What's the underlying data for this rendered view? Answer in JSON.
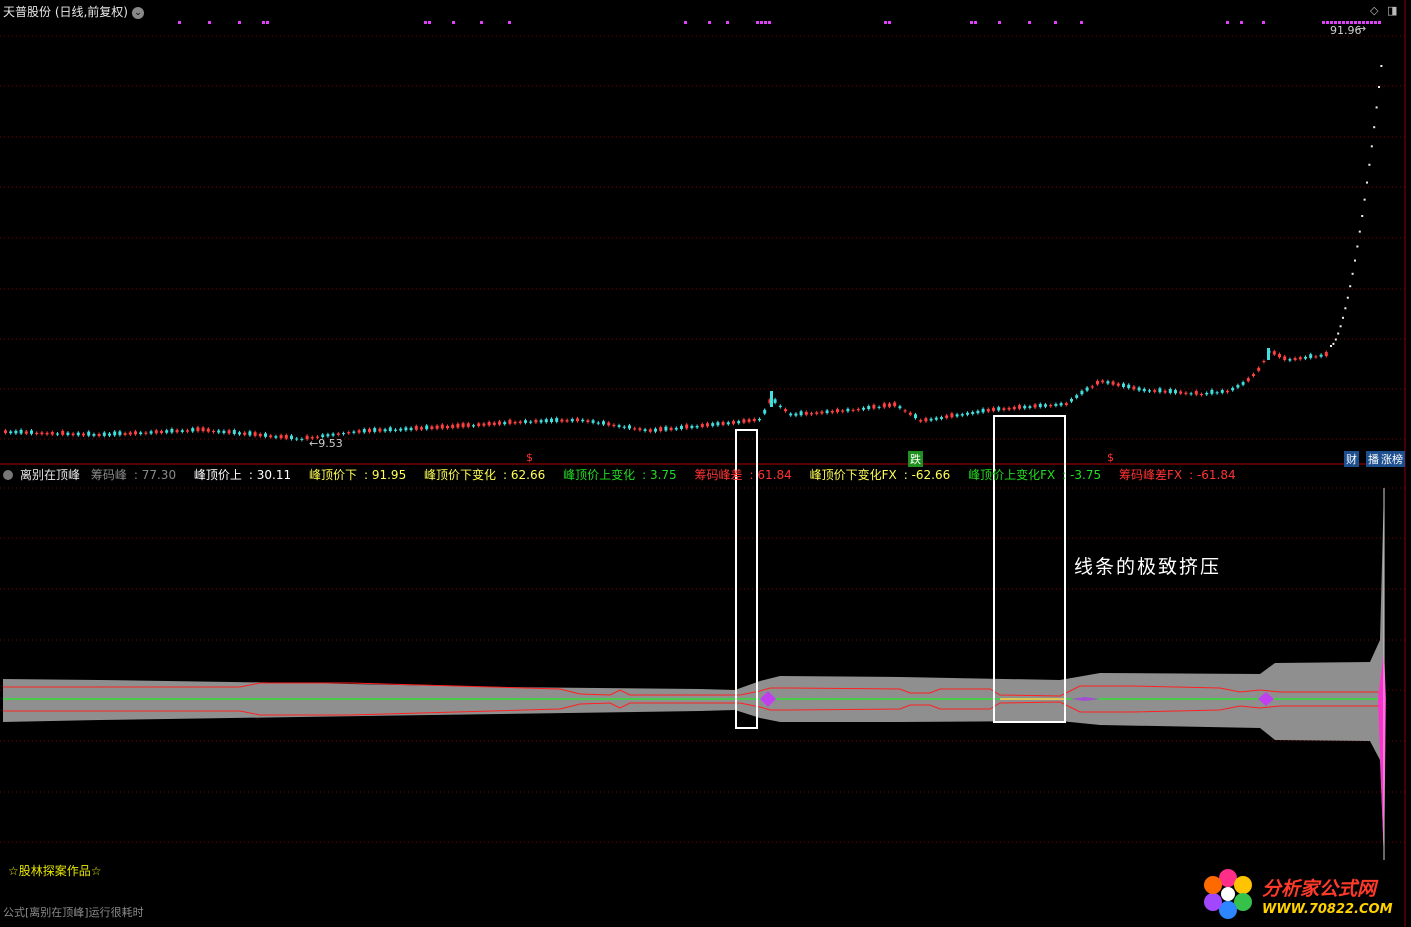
{
  "window": {
    "title": "天普股份 (日线,前复权)",
    "buttons": [
      "◇",
      "◨"
    ]
  },
  "price_panel": {
    "high_label": "91.96",
    "low_label": "←9.53",
    "markers": [
      "$",
      "跌",
      "$"
    ],
    "right_badges": [
      "财",
      "播",
      "涨榜"
    ]
  },
  "indicator": {
    "name": "离别在顶峰",
    "fields": [
      {
        "label": "筹码峰",
        "value": "77.30",
        "color": "#8a8a8a"
      },
      {
        "label": "峰顶价上",
        "value": "30.11",
        "color": "#ffffff"
      },
      {
        "label": "峰顶价下",
        "value": "91.95",
        "color": "#ffff55"
      },
      {
        "label": "峰顶价下变化",
        "value": "62.66",
        "color": "#ffff55"
      },
      {
        "label": "峰顶价上变化",
        "value": "3.75",
        "color": "#22dd22"
      },
      {
        "label": "筹码峰差",
        "value": "61.84",
        "color": "#ff3333"
      },
      {
        "label": "峰顶价下变化FX",
        "value": "-62.66",
        "color": "#ffff55"
      },
      {
        "label": "峰顶价上变化FX",
        "value": "-3.75",
        "color": "#22dd22"
      },
      {
        "label": "筹码峰差FX",
        "value": "-61.84",
        "color": "#ff3333"
      }
    ]
  },
  "annotation": "线条的极致挤压",
  "author": "☆股林探案作品☆",
  "status_bar": "公式[离别在顶峰]运行很耗时",
  "watermark": {
    "name": "分析家公式网",
    "url": "WWW.70822.COM"
  }
}
